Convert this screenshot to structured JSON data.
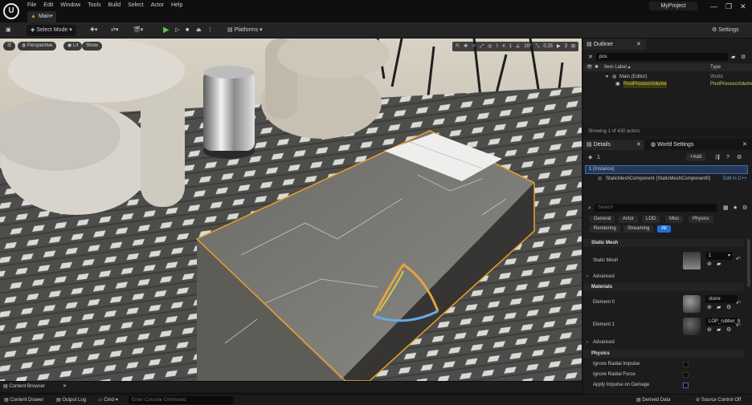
{
  "menu": {
    "logo": "U",
    "items": [
      "File",
      "Edit",
      "Window",
      "Tools",
      "Build",
      "Select",
      "Actor",
      "Help"
    ],
    "level_tab": "Main•",
    "project": "MyProject",
    "window_buttons": [
      "—",
      "❐",
      "✕"
    ]
  },
  "toolbar": {
    "save": "💾",
    "select_mode": "Select Mode",
    "platforms": "Platforms",
    "settings": "Settings"
  },
  "viewport": {
    "view_mode": "Perspective",
    "lit": "Lit",
    "show": "Show",
    "snap_angle": "1",
    "snap_rot": "10°",
    "snap_scale": "0.25",
    "camera_speed": "3"
  },
  "outliner": {
    "title": "Outliner",
    "search_value": "pos",
    "col_label": "Item Label ▴",
    "col_type": "Type",
    "rows": [
      {
        "label": "Main (Editor)",
        "type": "World"
      },
      {
        "label": "PostProcessVolume",
        "type": "PostProcessVolume"
      }
    ],
    "status": "Showing 1 of 430 actors"
  },
  "details": {
    "tab_details": "Details",
    "tab_world": "World Settings",
    "selection_count": "1",
    "add_label": "+Add",
    "instance_label": "1 (Instance)",
    "component": "StaticMeshComponent (StaticMeshComponent0)",
    "edit_cpp": "Edit in C++",
    "search_placeholder": "Search",
    "filters": [
      "General",
      "Actor",
      "LOD",
      "Misc",
      "Physics"
    ],
    "filters2": [
      "Rendering",
      "Streaming",
      "All"
    ],
    "sections": {
      "static_mesh": "Static Mesh",
      "advanced": "Advanced",
      "materials": "Materials",
      "physics": "Physics"
    },
    "static_mesh_label": "Static Mesh",
    "static_mesh_value": "1",
    "element0_label": "Element 0",
    "element0_value": "stone",
    "element1_label": "Element 1",
    "element1_value": "LOP_rubber_b",
    "physics_rows": [
      "Ignore Radial Impulse",
      "Ignore Radial Force",
      "Apply Impulse on Damage"
    ]
  },
  "bottom": {
    "content_browser": "Content Browser",
    "content_drawer": "Content Drawer",
    "output_log": "Output Log",
    "cmd": "Cmd",
    "console_placeholder": "Enter Console Command",
    "derived_data": "Derived Data",
    "source_control": "Source Control Off"
  },
  "colors": {
    "accent_blue": "#1f6fd6",
    "selection_orange": "#e8a326",
    "play_green": "#5fc44f",
    "highlight_yellow": "#c7b400"
  }
}
